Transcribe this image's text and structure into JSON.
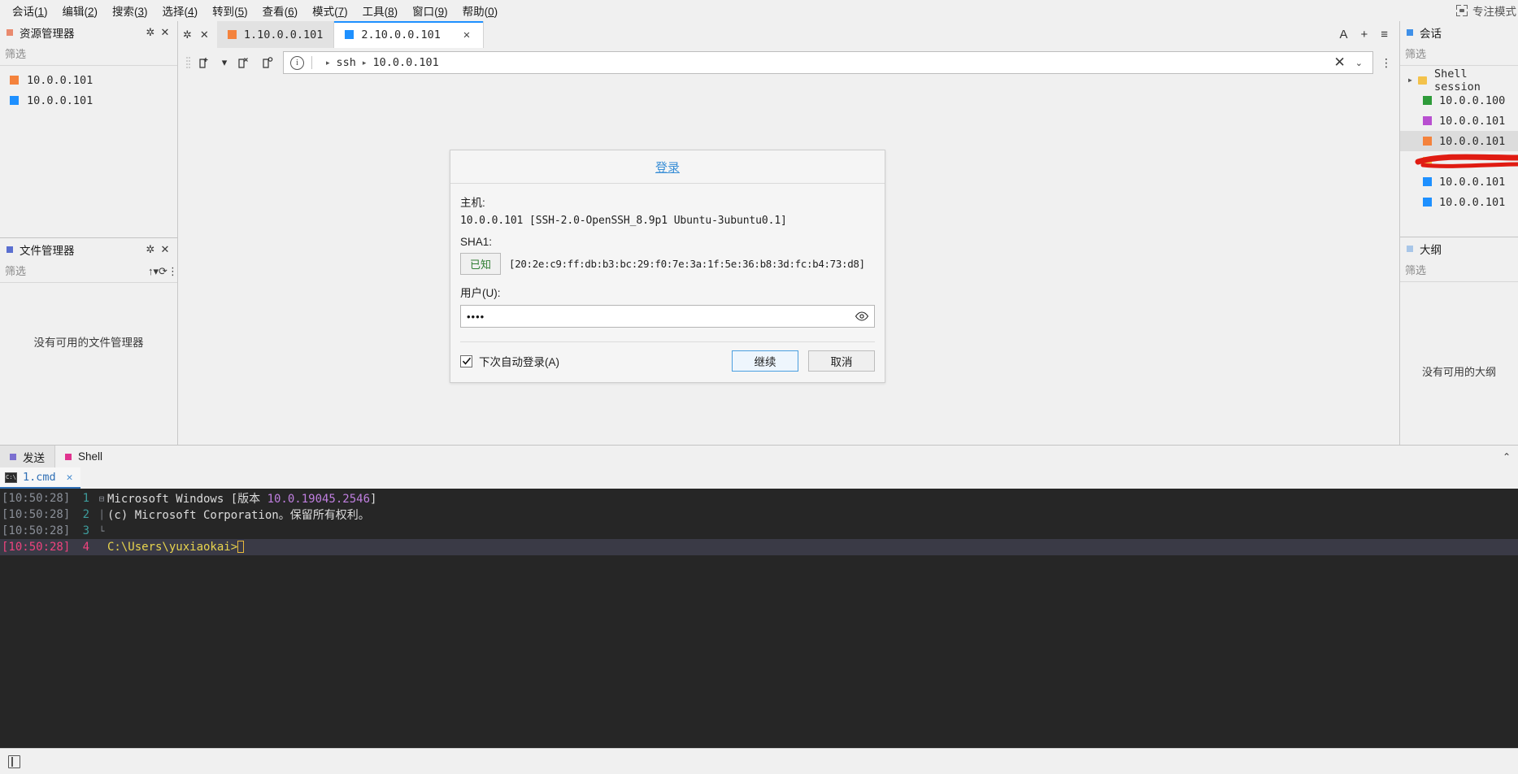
{
  "menubar": {
    "items": [
      {
        "label": "会话",
        "accel": "1"
      },
      {
        "label": "编辑",
        "accel": "2"
      },
      {
        "label": "搜索",
        "accel": "3"
      },
      {
        "label": "选择",
        "accel": "4"
      },
      {
        "label": "转到",
        "accel": "5"
      },
      {
        "label": "查看",
        "accel": "6"
      },
      {
        "label": "模式",
        "accel": "7"
      },
      {
        "label": "工具",
        "accel": "8"
      },
      {
        "label": "窗口",
        "accel": "9"
      },
      {
        "label": "帮助",
        "accel": "0"
      }
    ],
    "focus_mode": "专注模式"
  },
  "explorer": {
    "title": "资源管理器",
    "filter_placeholder": "筛选",
    "items": [
      {
        "label": "10.0.0.101",
        "color": "#f4823c"
      },
      {
        "label": "10.0.0.101",
        "color": "#1e90ff"
      }
    ]
  },
  "filemanager": {
    "title": "文件管理器",
    "filter_placeholder": "筛选",
    "empty_text": "没有可用的文件管理器"
  },
  "tabs": {
    "items": [
      {
        "label": "1.10.0.0.101",
        "color": "#f4823c",
        "active": false
      },
      {
        "label": "2.10.0.0.101",
        "color": "#1e90ff",
        "active": true
      }
    ],
    "close_glyph": "✕",
    "font_button": "A",
    "add_button": "+",
    "menu_button": "≡"
  },
  "address": {
    "scheme": "ssh",
    "host": "10.0.0.101",
    "separator": "▸",
    "clear_glyph": "✕",
    "dropdown_glyph": "⌄",
    "more_glyph": "⋮"
  },
  "dialog": {
    "title": "登录",
    "host_label": "主机:",
    "host_value": "10.0.0.101 [SSH-2.0-OpenSSH_8.9p1 Ubuntu-3ubuntu0.1]",
    "sha1_label": "SHA1:",
    "known_button": "已知",
    "fingerprint": "[20:2e:c9:ff:db:b3:bc:29:f0:7e:3a:1f:5e:36:b8:3d:fc:b4:73:d8]",
    "user_label": "用户(U):",
    "password_value": "••••",
    "password_placeholder": "",
    "autologin_label": "下次自动登录(A)",
    "autologin_checked": true,
    "continue_button": "继续",
    "cancel_button": "取消",
    "title_color": "#3b8fd6",
    "known_color": "#2f7d32"
  },
  "sessions": {
    "title": "会话",
    "filter_placeholder": "筛选",
    "group_label": "Shell session",
    "items": [
      {
        "label": "10.0.0.100",
        "color": "#2e9b3a",
        "selected": false,
        "redacted": false
      },
      {
        "label": "10.0.0.101",
        "color": "#b84fd0",
        "selected": false,
        "redacted": false
      },
      {
        "label": "10.0.0.101",
        "color": "#f4823c",
        "selected": true,
        "redacted": false
      },
      {
        "label": "",
        "color": "#f3c24b",
        "selected": false,
        "redacted": true
      },
      {
        "label": "10.0.0.101",
        "color": "#1e90ff",
        "selected": false,
        "redacted": false
      },
      {
        "label": "10.0.0.101",
        "color": "#1e90ff",
        "selected": false,
        "redacted": false
      }
    ]
  },
  "outline": {
    "title": "大纲",
    "filter_placeholder": "筛选",
    "empty_text": "没有可用的大纲"
  },
  "bottom": {
    "tabs": [
      {
        "label": "发送",
        "color": "#7b6fd0",
        "selected": true
      },
      {
        "label": "Shell",
        "color": "#e0338f",
        "selected": false
      }
    ],
    "collapse_glyph": "⌃",
    "file_tab": {
      "label": "1.cmd",
      "icon": "cmd-icon",
      "close_glyph": "✕"
    },
    "terminal": {
      "lines": [
        {
          "time": "[10:50:28]",
          "no": "1",
          "fold": "⊟",
          "text": "Microsoft Windows [版本 10.0.19045.2546]",
          "current": false
        },
        {
          "time": "[10:50:28]",
          "no": "2",
          "fold": "│",
          "text": "(c) Microsoft Corporation。保留所有权利。",
          "current": false
        },
        {
          "time": "[10:50:28]",
          "no": "3",
          "fold": "└",
          "text": "",
          "current": false
        },
        {
          "time": "[10:50:28]",
          "no": "4",
          "fold": "",
          "text": "C:\\Users\\yuxiaokai>",
          "current": true
        }
      ],
      "version_number": "10.0.19045.2546"
    }
  },
  "statusbar": {
    "icon": "book-icon"
  }
}
